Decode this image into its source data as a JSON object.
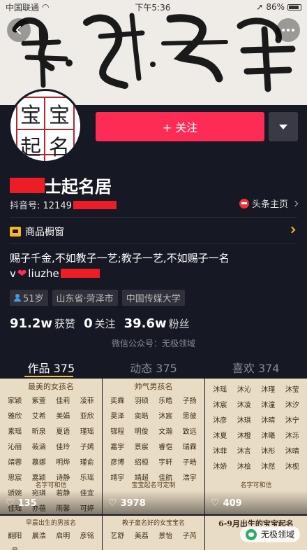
{
  "status_bar": {
    "carrier": "中国联通",
    "time": "下午5:36",
    "battery": "86%"
  },
  "cover": {
    "calligraphy": "龍成子堂",
    "signature": "示之第和書寓康"
  },
  "avatar": {
    "seal_chars": [
      "宝",
      "宝",
      "起",
      "名"
    ]
  },
  "actions": {
    "follow_label": "+ 关注"
  },
  "profile": {
    "name_suffix": "士起名居",
    "douyin_id_prefix": "抖音号: 12149",
    "toutiao_label": "头条主页",
    "shop_label": "商品橱窗",
    "bio_line1": "赐子千金,不如教子一艺;教子一艺,不如赐子一名",
    "bio_line2_prefix": "v",
    "bio_line2_text": "liuzhe",
    "tags": [
      "51岁",
      "山东省·菏泽市",
      "中国传媒大学"
    ]
  },
  "stats": [
    {
      "num": "91.2w",
      "label": "获赞"
    },
    {
      "num": "0",
      "label": "关注"
    },
    {
      "num": "39.6w",
      "label": "粉丝"
    }
  ],
  "wechat_note": "微信公众号：无极领域",
  "tabs": [
    {
      "label": "作品 375",
      "active": true
    },
    {
      "label": "动态 375",
      "active": false
    },
    {
      "label": "喜欢 374",
      "active": false
    }
  ],
  "videos": [
    {
      "title": "最美的女孩名",
      "names": [
        "家颖",
        "紫萱",
        "佳莉",
        "凌菲",
        "雅欣",
        "艾希",
        "美娟",
        "亚欣",
        "素瑶",
        "昕泉",
        "夏语",
        "瑾瑶",
        "沁丽",
        "莜涵",
        "佳玲",
        "子嫣",
        "靖蓉",
        "慕娜",
        "明烨",
        "瑾俞",
        "思宸",
        "嘉颖",
        "诗静",
        "乐瑶",
        "骄婉",
        "宛琪",
        "若静",
        "佳宜",
        "佳瑶",
        "亦蓓",
        "雨馨",
        "可婷"
      ],
      "likes": "135",
      "note": "名字可和信"
    },
    {
      "title": "帅气男孩名",
      "names": [
        "奕霖",
        "羽硕",
        "乐皓",
        "子扬",
        "昊泽",
        "奕皓",
        "沐宸",
        "思彼",
        "锦程",
        "明俊",
        "文瀚",
        "致远",
        "嘉宇",
        "景宸",
        "睿恺",
        "瑞霖",
        "彦博",
        "绍桓",
        "宇轩",
        "子皓",
        "靖宇",
        "靖超",
        "佳航",
        "浩宇"
      ],
      "likes": "3978",
      "note": "宝宝起名可定制"
    },
    {
      "title": "",
      "names": [
        "沐瑶",
        "沐沁",
        "沐瑾",
        "沐莹",
        "沐宸",
        "沐凌",
        "沐潼",
        "沐汐",
        "沐彦",
        "沐琪",
        "沐晴",
        "沐宁",
        "沐夏",
        "沐橙",
        "沐曦",
        "沐泺",
        "沐菲",
        "沐言",
        "沐彤",
        "沐晴",
        "沐娇",
        "沐桧",
        "沐然",
        "沐枧"
      ],
      "likes": "409",
      "note": "名字可和信"
    },
    {
      "title": "早晨出生的男孩名",
      "names": [
        "翻阳",
        "晨浩",
        "启明",
        "彦铭",
        "晨",
        "",
        "",
        ""
      ],
      "likes": "",
      "note": ""
    },
    {
      "title": "教子童名好的女宝宝名",
      "names": [
        "艺舒",
        "美荔",
        "景怡",
        "子芮"
      ],
      "likes": "",
      "note": ""
    },
    {
      "title": "6-9月出生的宝宝起名",
      "names": [],
      "likes": "",
      "note": ""
    }
  ],
  "watermark": "无极领域"
}
